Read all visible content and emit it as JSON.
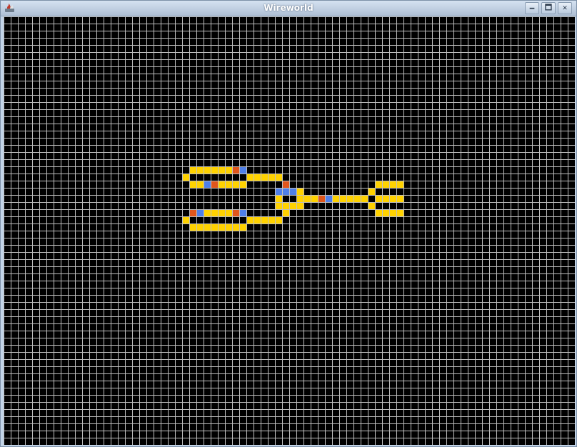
{
  "window": {
    "title": "Wireworld",
    "minimize_label": "🗕",
    "maximize_label": "🗖",
    "close_label": "✕"
  },
  "colors": {
    "empty": "#000000",
    "grid": "#bfbfbf",
    "conductor": "#ffd200",
    "electron_head": "#4f7fe8",
    "electron_tail": "#e0561c"
  },
  "cells": {
    "conductor": [
      [
        26,
        21
      ],
      [
        27,
        21
      ],
      [
        28,
        21
      ],
      [
        29,
        21
      ],
      [
        30,
        21
      ],
      [
        31,
        21
      ],
      [
        25,
        22
      ],
      [
        34,
        22
      ],
      [
        35,
        22
      ],
      [
        36,
        22
      ],
      [
        37,
        22
      ],
      [
        38,
        22
      ],
      [
        26,
        23
      ],
      [
        27,
        23
      ],
      [
        30,
        23
      ],
      [
        31,
        23
      ],
      [
        32,
        23
      ],
      [
        33,
        23
      ],
      [
        41,
        24
      ],
      [
        38,
        25
      ],
      [
        41,
        25
      ],
      [
        42,
        25
      ],
      [
        43,
        25
      ],
      [
        45,
        25
      ],
      [
        46,
        25
      ],
      [
        47,
        25
      ],
      [
        48,
        25
      ],
      [
        49,
        25
      ],
      [
        50,
        25
      ],
      [
        52,
        25
      ],
      [
        53,
        25
      ],
      [
        54,
        25
      ],
      [
        55,
        25
      ],
      [
        38,
        26
      ],
      [
        39,
        26
      ],
      [
        40,
        26
      ],
      [
        41,
        26
      ],
      [
        51,
        26
      ],
      [
        27,
        27
      ],
      [
        28,
        27
      ],
      [
        29,
        27
      ],
      [
        30,
        27
      ],
      [
        31,
        27
      ],
      [
        39,
        27
      ],
      [
        25,
        28
      ],
      [
        34,
        28
      ],
      [
        35,
        28
      ],
      [
        36,
        28
      ],
      [
        37,
        28
      ],
      [
        38,
        28
      ],
      [
        26,
        29
      ],
      [
        27,
        29
      ],
      [
        28,
        29
      ],
      [
        29,
        29
      ],
      [
        30,
        29
      ],
      [
        31,
        29
      ],
      [
        32,
        29
      ],
      [
        33,
        29
      ],
      [
        51,
        24
      ],
      [
        52,
        23
      ],
      [
        53,
        23
      ],
      [
        54,
        23
      ],
      [
        55,
        23
      ],
      [
        52,
        27
      ],
      [
        53,
        27
      ],
      [
        54,
        27
      ],
      [
        55,
        27
      ]
    ],
    "head": [
      [
        33,
        21
      ],
      [
        28,
        23
      ],
      [
        38,
        24
      ],
      [
        39,
        24
      ],
      [
        40,
        24
      ],
      [
        45,
        25
      ],
      [
        27,
        27
      ],
      [
        33,
        27
      ]
    ],
    "tail": [
      [
        32,
        21
      ],
      [
        29,
        23
      ],
      [
        39,
        23
      ],
      [
        44,
        25
      ],
      [
        26,
        27
      ],
      [
        32,
        27
      ]
    ]
  }
}
